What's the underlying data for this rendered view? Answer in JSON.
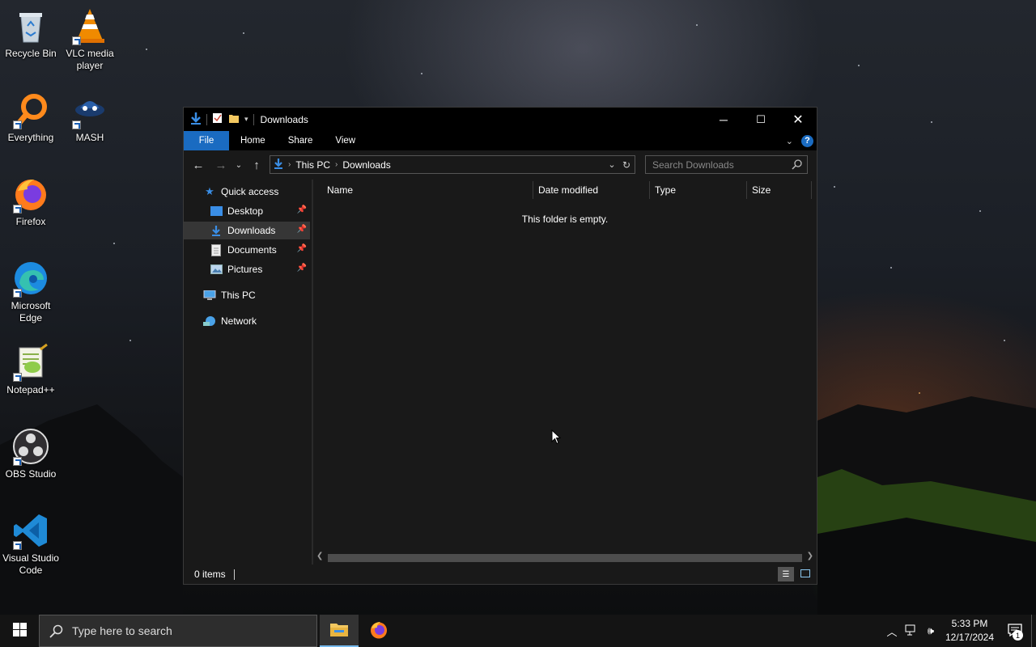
{
  "desktop": {
    "icons": [
      {
        "label": "Recycle Bin",
        "icon": "recycle-bin-icon"
      },
      {
        "label": "VLC media player",
        "icon": "vlc-icon"
      },
      {
        "label": "Everything",
        "icon": "everything-icon"
      },
      {
        "label": "MASH",
        "icon": "mash-icon"
      },
      {
        "label": "Firefox",
        "icon": "firefox-icon"
      },
      {
        "label": "Microsoft Edge",
        "icon": "edge-icon"
      },
      {
        "label": "Notepad++",
        "icon": "notepadpp-icon"
      },
      {
        "label": "OBS Studio",
        "icon": "obs-icon"
      },
      {
        "label": "Visual Studio Code",
        "icon": "vscode-icon"
      }
    ]
  },
  "explorer": {
    "title": "Downloads",
    "ribbon_tabs": [
      "File",
      "Home",
      "Share",
      "View"
    ],
    "address": {
      "crumbs": [
        "This PC",
        "Downloads"
      ]
    },
    "search_placeholder": "Search Downloads",
    "nav": {
      "quick_access": "Quick access",
      "pinned": [
        "Desktop",
        "Downloads",
        "Documents",
        "Pictures"
      ],
      "this_pc": "This PC",
      "network": "Network",
      "selected": "Downloads"
    },
    "columns": [
      "Name",
      "Date modified",
      "Type",
      "Size"
    ],
    "empty_message": "This folder is empty.",
    "status_items": "0 items"
  },
  "taskbar": {
    "search_placeholder": "Type here to search",
    "apps": [
      "file-explorer-icon",
      "firefox-icon"
    ],
    "clock_time": "5:33 PM",
    "clock_date": "12/17/2024",
    "notification_count": "1"
  },
  "colors": {
    "accent": "#1a6bc1",
    "window_bg": "#191919",
    "taskbar_bg": "#141414"
  }
}
